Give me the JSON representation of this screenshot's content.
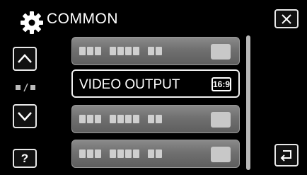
{
  "header": {
    "title": "COMMON",
    "icon": "gear-icon"
  },
  "nav": {
    "up_icon": "chevron-up-icon",
    "down_icon": "chevron-down-icon",
    "page_indicator": "■/■",
    "help_label": "?",
    "close_icon": "close-icon",
    "back_icon": "return-icon"
  },
  "menu": {
    "items": [
      {
        "label": "",
        "state": "placeholder"
      },
      {
        "label": "VIDEO OUTPUT",
        "value": "16:9",
        "state": "selected"
      },
      {
        "label": "",
        "state": "placeholder"
      },
      {
        "label": "",
        "state": "placeholder"
      }
    ]
  }
}
